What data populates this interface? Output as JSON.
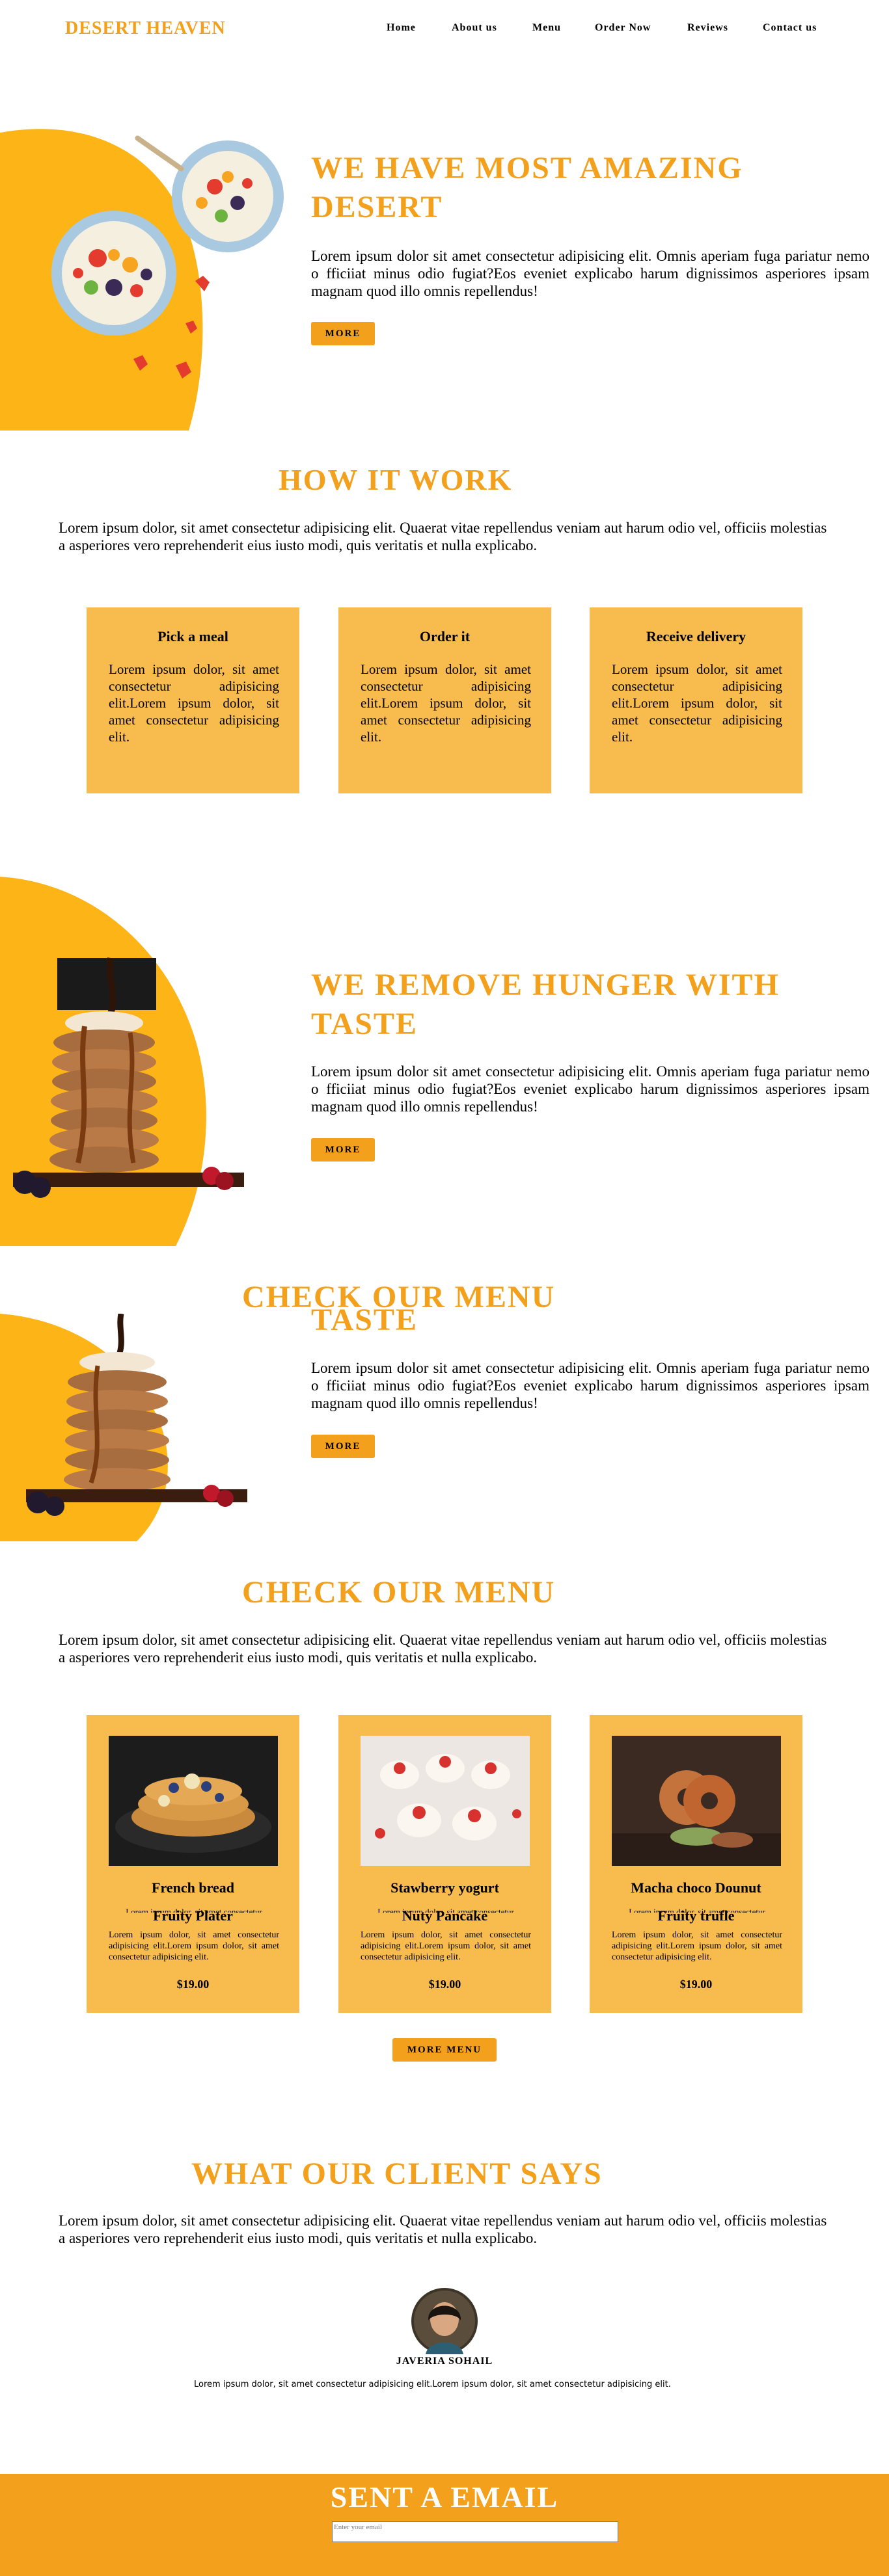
{
  "nav": {
    "brand": "DESERT HEAVEN",
    "links": [
      "Home",
      "About us",
      "Menu",
      "Order Now",
      "Reviews",
      "Contact us"
    ]
  },
  "hero": {
    "title_line1": "WE HAVE MOST AMAZING",
    "title_line2": "DESERT",
    "text": "Lorem ipsum dolor sit amet consectetur adipisicing elit. Omnis aperiam fuga pariatur nemo o fficiiat minus odio fugiat?Eos eveniet explicabo harum dignissimos asperiores ipsam magnam quod illo omnis repellendus!",
    "button": "MORE"
  },
  "how": {
    "title": "HOW IT WORK",
    "text": "Lorem ipsum dolor, sit amet consectetur adipisicing elit. Quaerat vitae repellendus veniam aut harum odio vel, officiis molestias a asperiores vero reprehenderit eius iusto modi, quis veritatis et nulla explicabo.",
    "steps": [
      {
        "title": "Pick a meal",
        "text": "Lorem ipsum dolor, sit amet consectetur adipisicing elit.Lorem ipsum dolor, sit amet consectetur adipisicing elit."
      },
      {
        "title": "Order it",
        "text": "Lorem ipsum dolor, sit amet consectetur adipisicing elit.Lorem ipsum dolor, sit amet consectetur adipisicing elit."
      },
      {
        "title": "Receive delivery",
        "text": "Lorem ipsum dolor, sit amet consectetur adipisicing elit.Lorem ipsum dolor, sit amet consectetur adipisicing elit."
      }
    ]
  },
  "hunger": {
    "title_line1": "WE REMOVE HUNGER WITH",
    "title_line2": "TASTE",
    "text": "Lorem ipsum dolor sit amet consectetur adipisicing elit. Omnis aperiam fuga pariatur nemo o fficiiat minus odio fugiat?Eos eveniet explicabo harum dignissimos asperiores ipsam magnam quod illo omnis repellendus!",
    "button": "MORE"
  },
  "overlap": {
    "title": "CHECK OUR MENU",
    "clipped_title": "TASTE",
    "text": "Lorem ipsum dolor sit amet consectetur adipisicing elit. Omnis aperiam fuga pariatur nemo o fficiiat minus odio fugiat?Eos eveniet explicabo harum dignissimos asperiores ipsam magnam quod illo omnis repellendus!",
    "button": "MORE"
  },
  "menu": {
    "title": "CHECK OUR MENU",
    "text": "Lorem ipsum dolor, sit amet consectetur adipisicing elit. Quaerat vitae repellendus veniam aut harum odio vel, officiis molestias a asperiores vero reprehenderit eius iusto modi, quis veritatis et nulla explicabo.",
    "items": [
      {
        "name": "French bread",
        "ghost": "Lorem ipsum dolor, sit amet consectetur",
        "name2": "Fruity Plater",
        "desc": "Lorem ipsum dolor, sit amet consectetur adipisicing elit.Lorem ipsum dolor, sit amet consectetur adipisicing elit.",
        "price": "$19.00"
      },
      {
        "name": "Stawberry yogurt",
        "ghost": "Lorem ipsum dolor, sit amet consectetur",
        "name2": "Nuty Pancake",
        "desc": "Lorem ipsum dolor, sit amet consectetur adipisicing elit.Lorem ipsum dolor, sit amet consectetur adipisicing elit.",
        "price": "$19.00"
      },
      {
        "name": "Macha choco Dounut",
        "ghost": "Lorem ipsum dolor, sit amet consectetur",
        "name2": "Fruity trufle",
        "desc": "Lorem ipsum dolor, sit amet consectetur adipisicing elit.Lorem ipsum dolor, sit amet consectetur adipisicing elit.",
        "price": "$19.00"
      }
    ],
    "button": "MORE MENU"
  },
  "clients": {
    "title": "WHAT OUR CLIENT SAYS",
    "text": "Lorem ipsum dolor, sit amet consectetur adipisicing elit. Quaerat vitae repellendus veniam aut harum odio vel, officiis molestias a asperiores vero reprehenderit eius iusto modi, quis veritatis et nulla explicabo.",
    "name": "JAVERIA SOHAIL",
    "review": "Lorem ipsum dolor, sit amet consectetur adipisicing elit.Lorem ipsum dolor, sit amet consectetur adipisicing elit."
  },
  "email": {
    "title": "SENT A EMAIL",
    "placeholder": "Enter your email"
  },
  "colors": {
    "accent": "#f3a01c",
    "card": "#f7bb4e",
    "blob": "#fcb416"
  }
}
